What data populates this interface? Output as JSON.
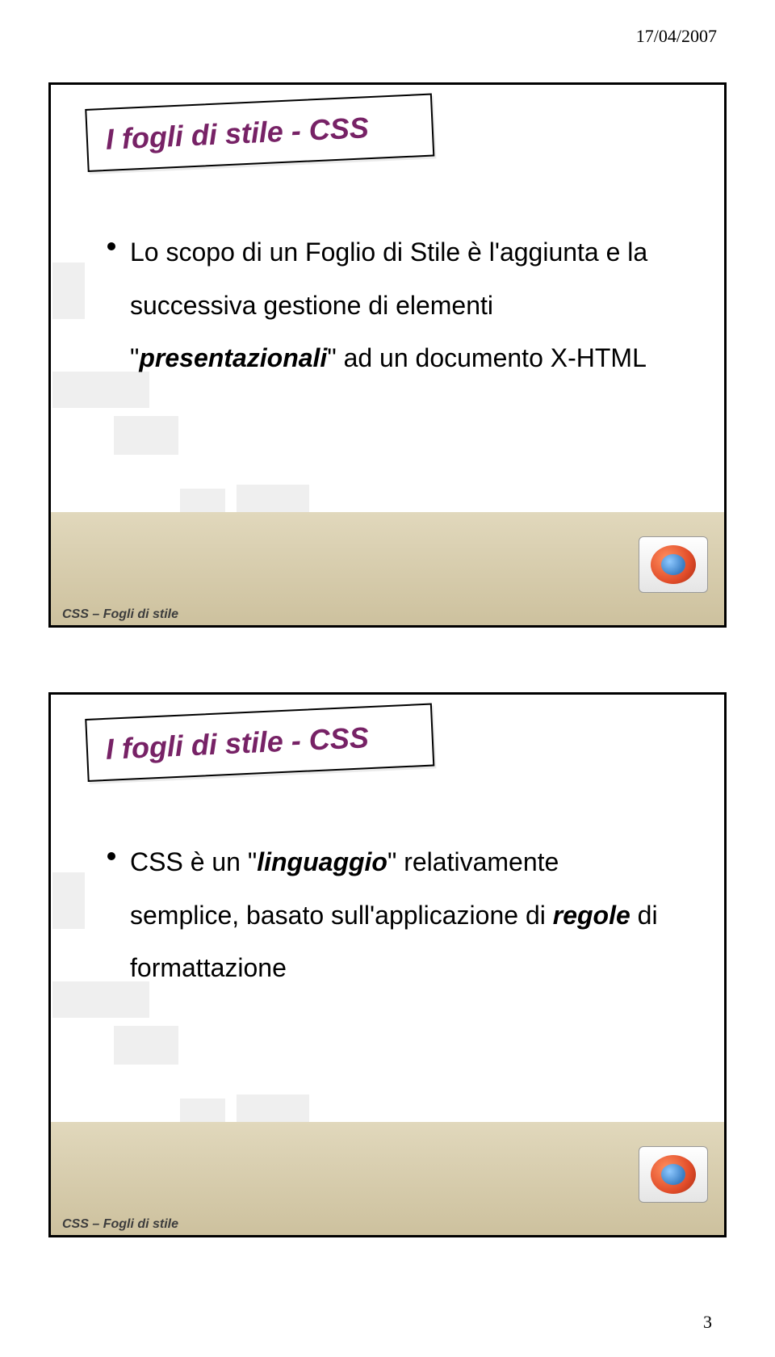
{
  "header": {
    "date": "17/04/2007"
  },
  "page_number": "3",
  "footer_label": "CSS – Fogli di stile",
  "slides": [
    {
      "title": "I fogli di stile - CSS",
      "bullet_prefix": "Lo scopo di un Foglio di Stile è l'aggiunta e la successiva gestione di elementi \"",
      "bullet_emph": "presentazionali",
      "bullet_suffix": "\" ad un documento X-HTML"
    },
    {
      "title": "I fogli di stile - CSS",
      "bullet_prefix": "CSS è un \"",
      "bullet_emph": "linguaggio",
      "bullet_suffix": "\" relativamente semplice, basato sull'applicazione di ",
      "bullet_emph2": "regole",
      "bullet_tail": " di formattazione"
    }
  ]
}
